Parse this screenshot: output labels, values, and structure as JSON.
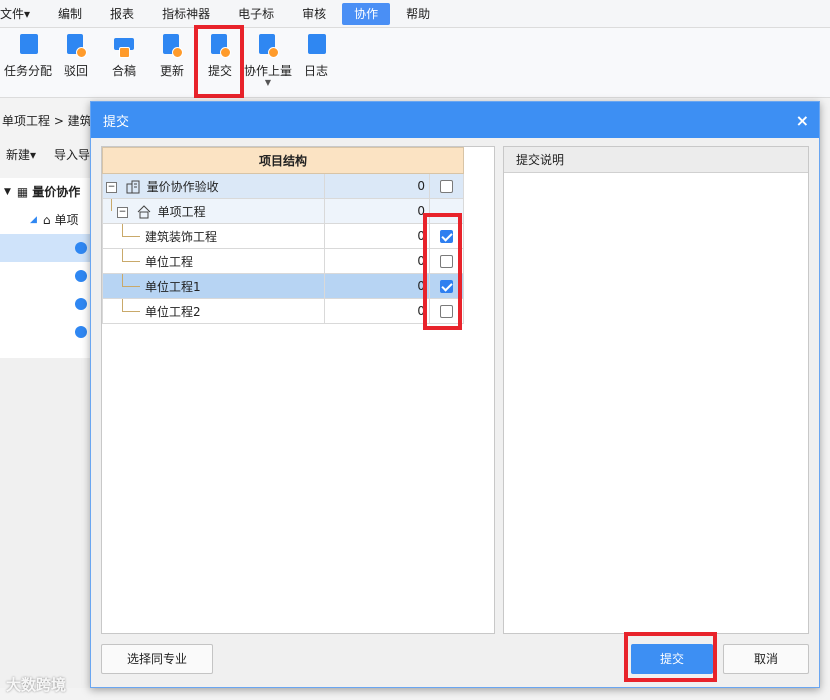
{
  "menubar": {
    "items": [
      "文件▾",
      "编制",
      "报表",
      "指标神器",
      "电子标",
      "审核",
      "协作",
      "帮助"
    ],
    "active": "协作"
  },
  "toolbar": {
    "tools": [
      {
        "label": "任务分配",
        "icon": "task-assign-icon"
      },
      {
        "label": "驳回",
        "icon": "reject-icon"
      },
      {
        "label": "合稿",
        "icon": "merge-icon"
      },
      {
        "label": "更新",
        "icon": "update-icon"
      },
      {
        "label": "提交",
        "icon": "submit-icon"
      },
      {
        "label": "协作上量",
        "icon": "collab-upload-icon"
      },
      {
        "label": "日志",
        "icon": "log-icon"
      }
    ]
  },
  "background": {
    "breadcrumb": "单项工程 > 建筑",
    "actions": [
      "新建▾",
      "导入导"
    ],
    "tree": [
      "量价协作",
      "单项",
      "",
      "",
      "",
      ""
    ]
  },
  "dialog": {
    "title": "提交",
    "close_icon": "×",
    "table": {
      "header": "项目结构",
      "rows": [
        {
          "name": "量价协作验收",
          "value": "0",
          "checked": false,
          "level": 0,
          "expander": "−"
        },
        {
          "name": "单项工程",
          "value": "0",
          "checked": null,
          "level": 1,
          "expander": "−"
        },
        {
          "name": "建筑装饰工程",
          "value": "0",
          "checked": true,
          "level": 2
        },
        {
          "name": "单位工程",
          "value": "0",
          "checked": false,
          "level": 2
        },
        {
          "name": "单位工程1",
          "value": "0",
          "checked": true,
          "level": 2
        },
        {
          "name": "单位工程2",
          "value": "0",
          "checked": false,
          "level": 2
        }
      ]
    },
    "right_panel_title": "提交说明",
    "buttons": {
      "select_same": "选择同专业",
      "submit": "提交",
      "cancel": "取消"
    }
  },
  "watermark": "大数跨境",
  "colors": {
    "accent": "#3d8ff3",
    "highlight": "#e8232b",
    "header": "#fbe3c3"
  }
}
